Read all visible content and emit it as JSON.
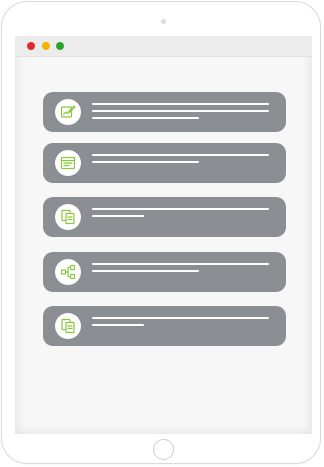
{
  "colors": {
    "close_dot": "#e02a2a",
    "minimize_dot": "#f0b400",
    "zoom_dot": "#2aa52a",
    "card_background": "#8b8f94",
    "icon_accent": "#8cc63f",
    "placeholder_line": "#ffffff"
  },
  "window": {
    "controls": [
      "close",
      "minimize",
      "zoom"
    ]
  },
  "cards": [
    {
      "icon": "edit-document-icon",
      "placeholder_lines": 3
    },
    {
      "icon": "browser-window-icon",
      "placeholder_lines": 2
    },
    {
      "icon": "copy-documents-icon",
      "placeholder_lines": 2
    },
    {
      "icon": "workflow-icon",
      "placeholder_lines": 2
    },
    {
      "icon": "copy-documents-icon",
      "placeholder_lines": 2
    }
  ]
}
